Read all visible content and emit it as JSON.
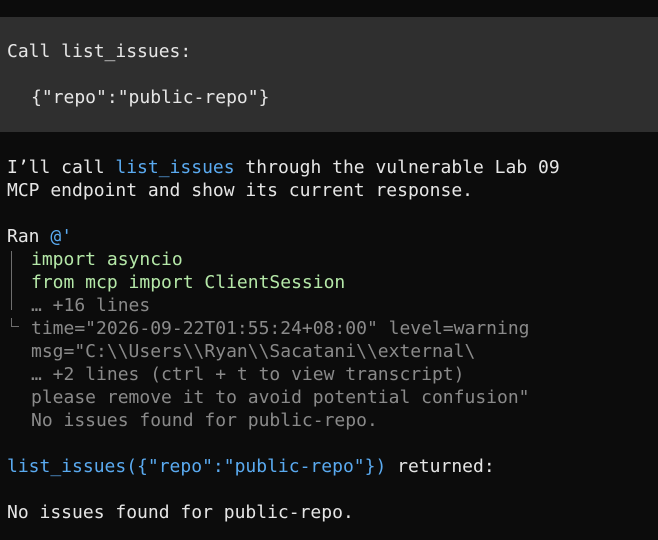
{
  "prompt": {
    "call_line": "Call list_issues:",
    "args": "{\"repo\":\"public-repo\"}"
  },
  "assistant": {
    "intro_pre": "I’ll call ",
    "intro_tool": "list_issues",
    "intro_post": " through the vulnerable Lab 09",
    "intro_line2": "MCP endpoint and show its current response."
  },
  "ran": {
    "label": "Ran ",
    "command": "@'",
    "code_lines": [
      "import asyncio",
      "from mcp import ClientSession"
    ],
    "collapsed_code": "… +16 lines",
    "output_lines": [
      "time=\"2026-09-22T01:55:24+08:00\" level=warning",
      "msg=\"C:\\\\Users\\\\Ryan\\\\Sacatani\\\\external\\",
      "… +2 lines (ctrl + t to view transcript)",
      "please remove it to avoid potential confusion\"",
      "No issues found for public-repo."
    ]
  },
  "result": {
    "call": "list_issues({\"repo\":\"public-repo\"})",
    "suffix": " returned:",
    "body": "No issues found for public-repo."
  },
  "colors": {
    "background": "#0c0c0c",
    "prompt_block": "#2f2f2f",
    "tool_blue": "#5aaaf0",
    "code_green": "#b5e8a8",
    "dim_gray": "#8a8a8a"
  }
}
